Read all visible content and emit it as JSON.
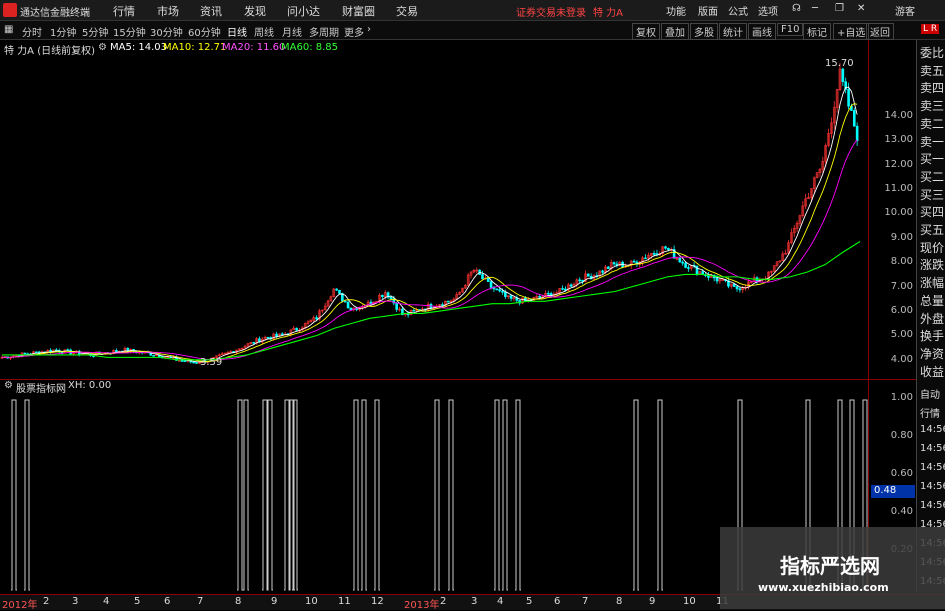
{
  "app": {
    "title": "通达信金融终端",
    "menu": [
      "行情",
      "市场",
      "资讯",
      "发现",
      "问小达",
      "财富圈",
      "交易"
    ],
    "warning": "证券交易未登录",
    "stock_name": "特 力A",
    "right_menu": [
      "功能",
      "版面",
      "公式",
      "选项",
      "游客"
    ]
  },
  "tabs": {
    "periods": [
      "分时",
      "1分钟",
      "5分钟",
      "15分钟",
      "30分钟",
      "60分钟",
      "日线",
      "周线",
      "月线",
      "多周期",
      "更多"
    ],
    "active": "日线",
    "right": [
      "复权",
      "叠加",
      "多股",
      "统计",
      "画线",
      "F10",
      "标记",
      "+自选",
      "返回"
    ]
  },
  "info": {
    "title": "特 力A (日线前复权)",
    "ma5": "MA5: 14.03",
    "ma10": "MA10: 12.71",
    "ma20": "MA20: 11.60",
    "ma60": "MA60: 8.85"
  },
  "main_axis": [
    "14.00",
    "13.00",
    "12.00",
    "11.00",
    "10.00",
    "9.00",
    "8.00",
    "7.00",
    "6.00",
    "5.00",
    "4.00"
  ],
  "annotations": {
    "high": "15.70",
    "low": "3.59"
  },
  "sub_header": {
    "name": "股票指标网",
    "xh": "XH: 0.00"
  },
  "sub_axis": [
    "1.00",
    "0.80",
    "0.60",
    "0.40",
    "0.20"
  ],
  "sub_current": "0.48",
  "side_panel": [
    "委比",
    "卖五",
    "卖四",
    "卖三",
    "卖二",
    "卖一",
    "买一",
    "买二",
    "买三",
    "买四",
    "买五",
    "现价",
    "涨跌",
    "涨幅",
    "总量",
    "外盘",
    "换手",
    "净资",
    "收益"
  ],
  "side_panel2": [
    "自动",
    "行情",
    "14:56",
    "14:56",
    "14:56",
    "14:56",
    "14:56",
    "14:56",
    "14:56",
    "14:56",
    "14:56"
  ],
  "timeline": [
    "2012年",
    "2",
    "3",
    "4",
    "5",
    "6",
    "7",
    "8",
    "9",
    "10",
    "11",
    "12",
    "2013年",
    "2",
    "3",
    "4",
    "5",
    "6",
    "7",
    "8",
    "9",
    "10",
    "11"
  ],
  "watermark": {
    "line1": "指标严选网",
    "line2": "www.xuezhibiao.com"
  },
  "colors": {
    "ma5": "#ffffff",
    "ma10": "#ffff00",
    "ma20": "#ff00ff",
    "ma60": "#00ff00",
    "up": "#ff3333",
    "down": "#00ffff",
    "signal": "#cccccc"
  },
  "chart_data": {
    "type": "line",
    "title": "特 力A (日线前复权)",
    "ylim": [
      3.5,
      15.8
    ],
    "series": [
      {
        "name": "price",
        "values": [
          4.1,
          4.2,
          4.3,
          4.4,
          4.3,
          4.2,
          4.3,
          4.4,
          4.3,
          4.2,
          4.0,
          3.9,
          4.0,
          4.3,
          4.6,
          4.9,
          5.0,
          5.3,
          5.7,
          6.9,
          6.1,
          6.3,
          6.8,
          5.8,
          6.1,
          6.3,
          6.5,
          7.7,
          7.0,
          6.5,
          6.4,
          6.6,
          6.8,
          7.3,
          7.5,
          7.9,
          7.9,
          8.3,
          8.6,
          8.0,
          7.6,
          7.3,
          6.9,
          7.2,
          7.5,
          8.6,
          10.5,
          12.0,
          15.7,
          13.2
        ]
      },
      {
        "name": "MA60",
        "values": [
          4.2,
          4.2,
          4.2,
          4.2,
          4.2,
          4.2,
          4.1,
          4.1,
          4.1,
          4.1,
          4.0,
          4.0,
          4.0,
          4.1,
          4.2,
          4.4,
          4.6,
          4.8,
          5.0,
          5.3,
          5.5,
          5.7,
          5.8,
          5.9,
          5.9,
          6.0,
          6.1,
          6.2,
          6.3,
          6.3,
          6.4,
          6.4,
          6.5,
          6.6,
          6.7,
          6.8,
          7.0,
          7.2,
          7.4,
          7.5,
          7.5,
          7.4,
          7.4,
          7.3,
          7.3,
          7.4,
          7.6,
          7.9,
          8.4,
          8.85
        ]
      }
    ],
    "signals": [
      14,
      27,
      240,
      246,
      265,
      270,
      287,
      292,
      295,
      356,
      364,
      377,
      437,
      451,
      497,
      505,
      518,
      636,
      660,
      740,
      808,
      840,
      852,
      865
    ]
  }
}
